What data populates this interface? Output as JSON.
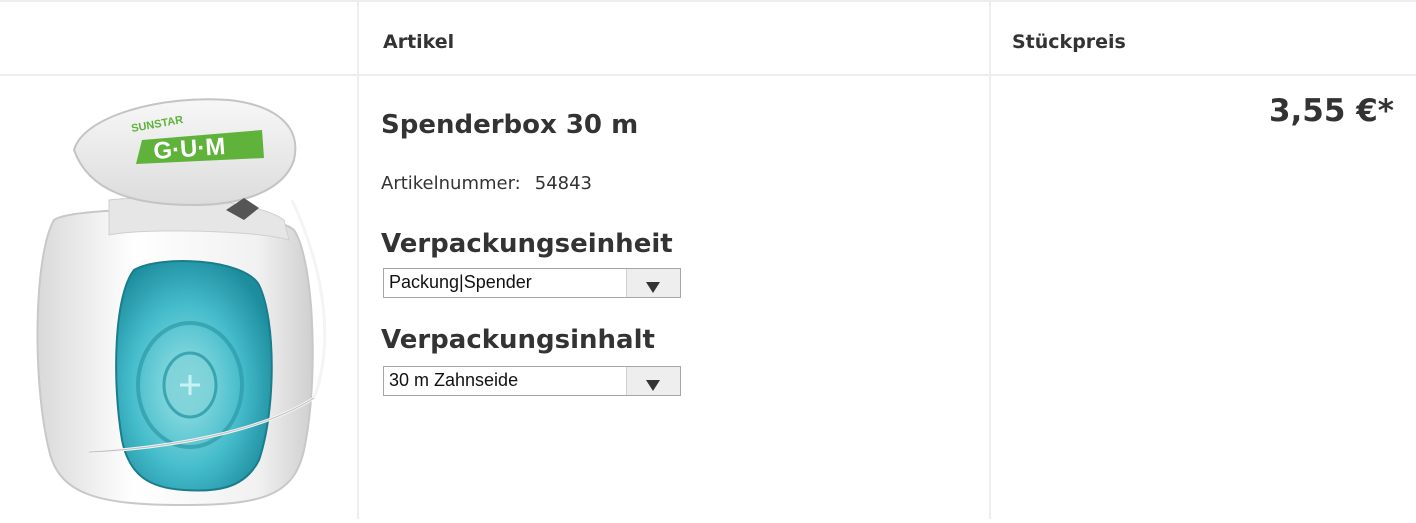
{
  "table": {
    "header": {
      "article": "Artikel",
      "unit_price": "Stückpreis"
    }
  },
  "product": {
    "image_name": "gum-floss-dispenser",
    "title": "Spenderbox 30 m",
    "article_number_label": "Artikelnummer:",
    "article_number": "54843",
    "packaging_unit": {
      "label": "Verpackungseinheit",
      "selected": "Packung|Spender"
    },
    "packaging_content": {
      "label": "Verpackungsinhalt",
      "selected": "30 m Zahnseide"
    },
    "price": "3,55 €*"
  },
  "colors": {
    "brand_green": "#5fb23a",
    "container_teal": "#3fb7c4",
    "border": "#eeeeee"
  }
}
